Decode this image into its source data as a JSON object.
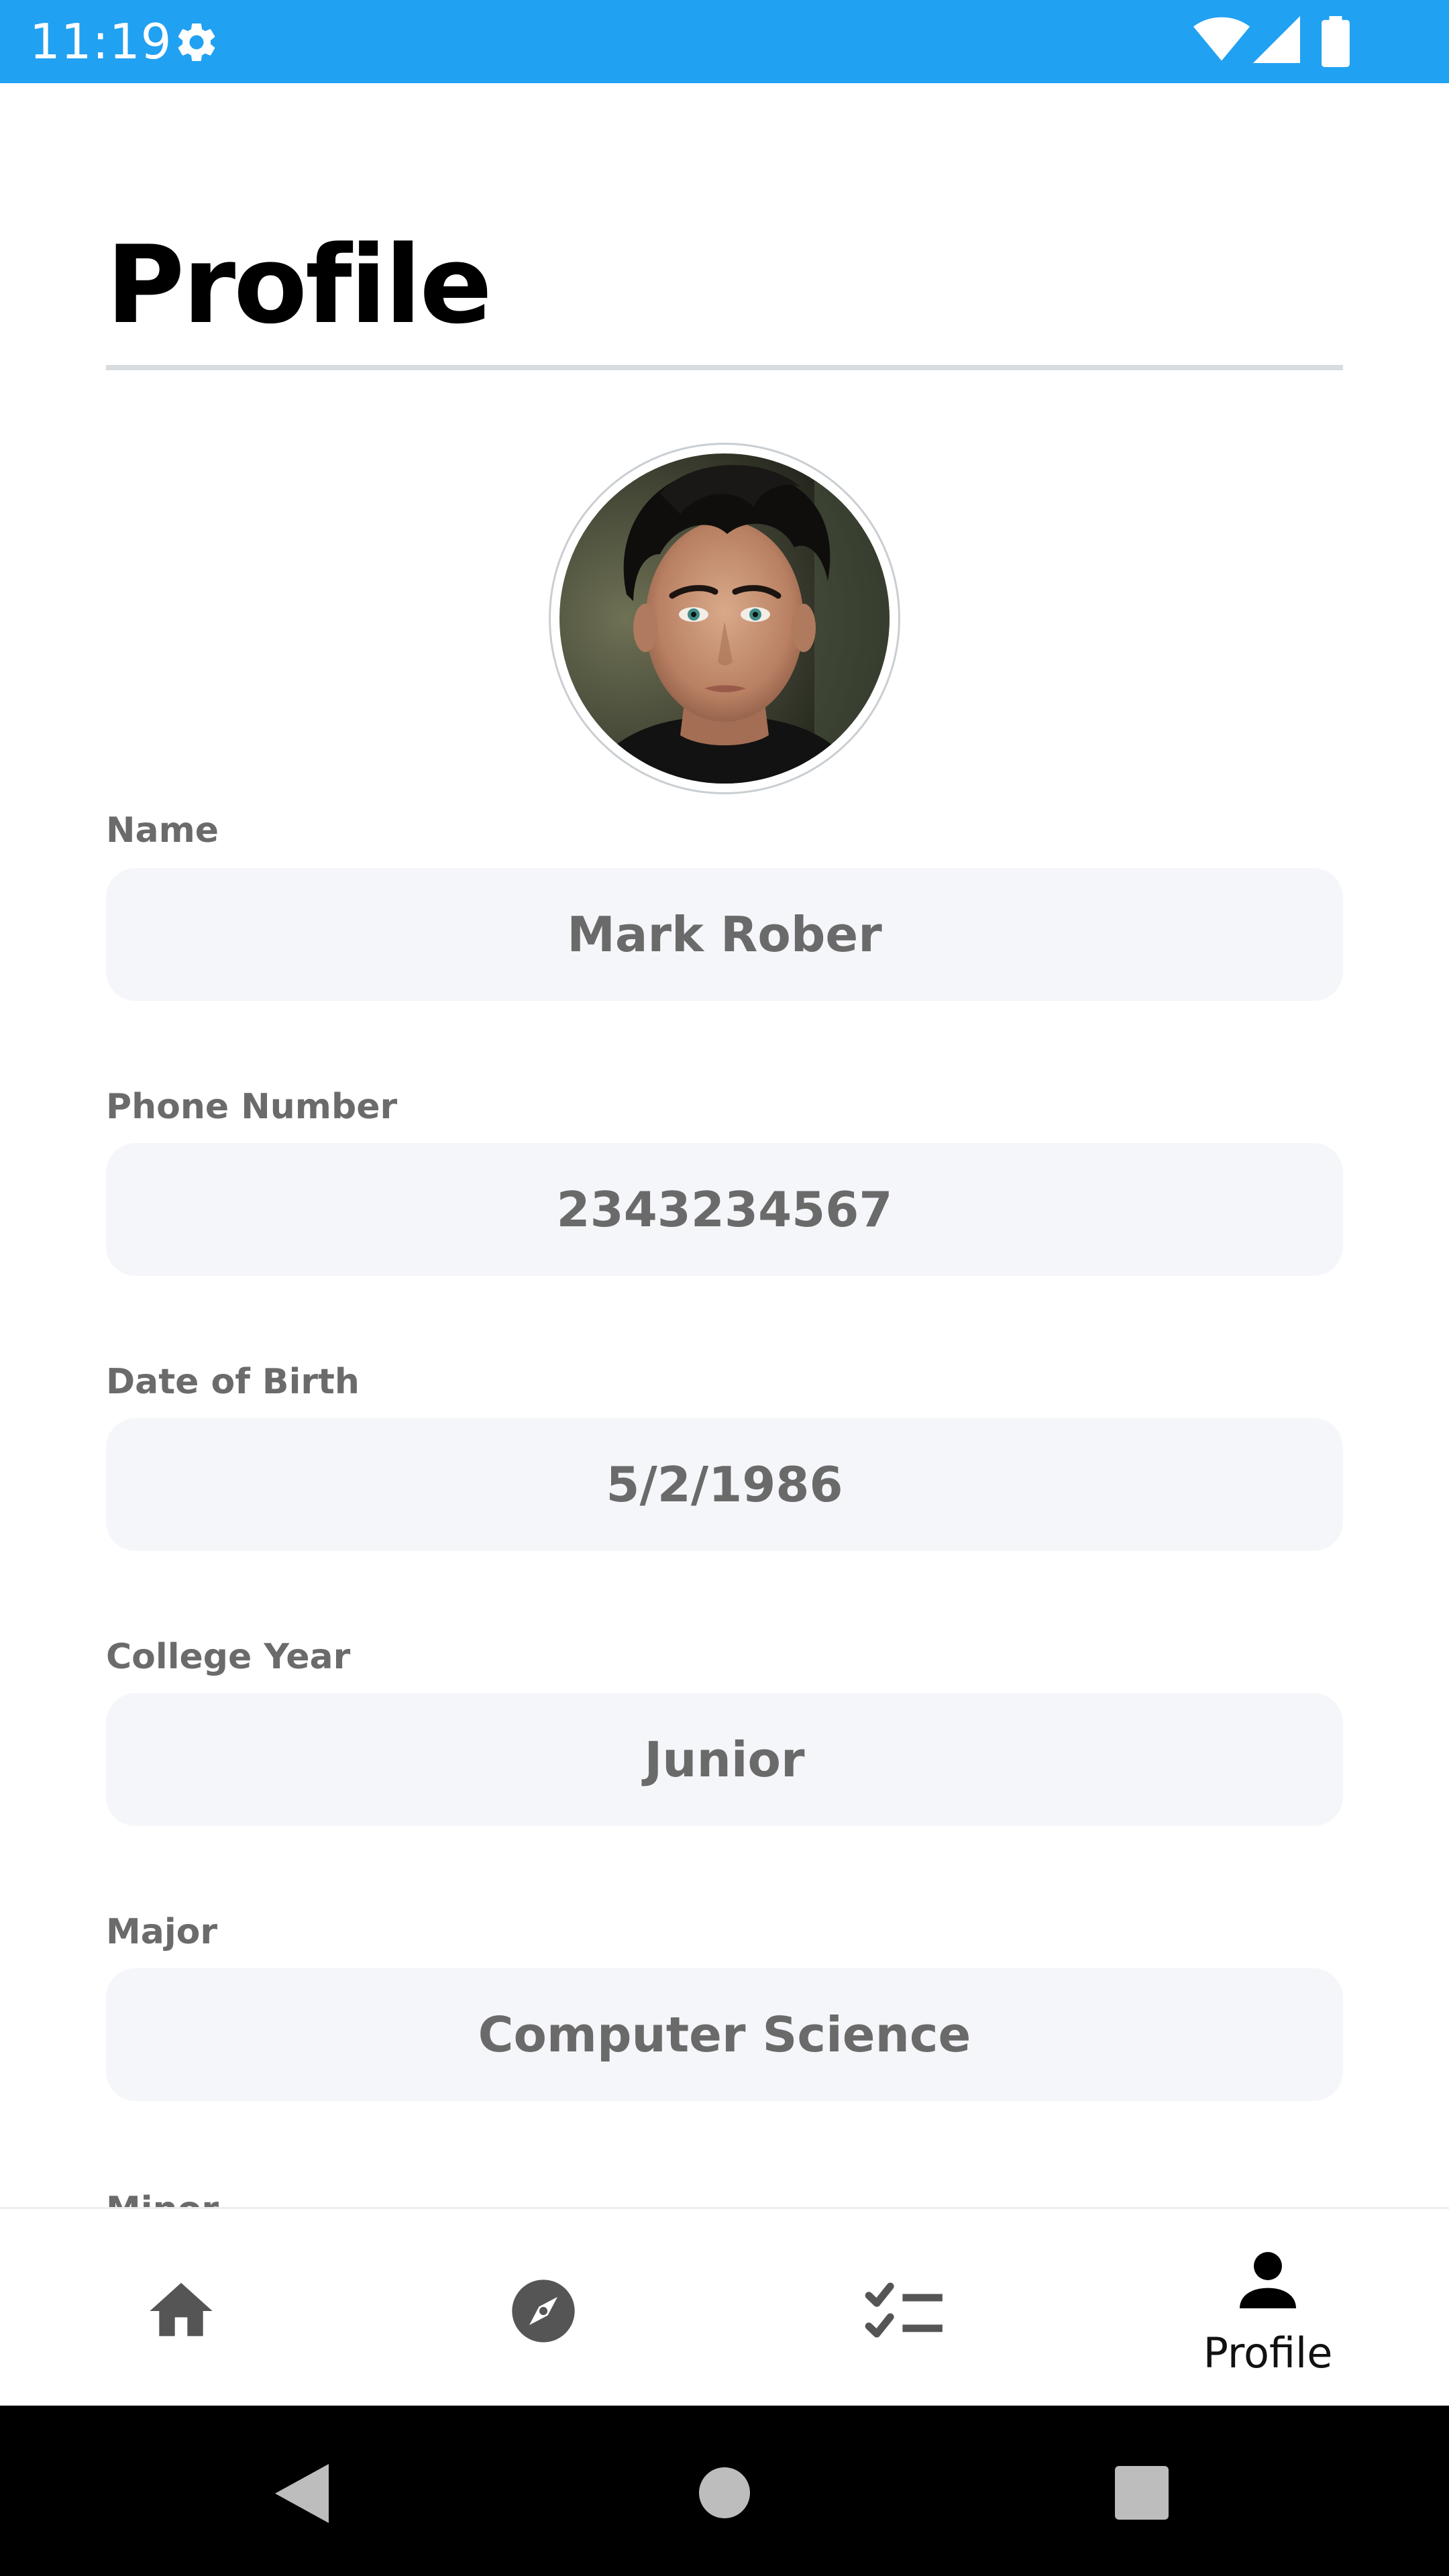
{
  "status_bar": {
    "time": "11:19",
    "background_color": "#21a1f1",
    "icons": [
      "gear-icon",
      "wifi-icon",
      "signal-icon",
      "battery-icon"
    ]
  },
  "page": {
    "title": "Profile"
  },
  "avatar": {
    "icon": "avatar-photo"
  },
  "fields": {
    "name": {
      "label": "Name",
      "value": "Mark Rober"
    },
    "phone": {
      "label": "Phone Number",
      "value": "2343234567"
    },
    "dob": {
      "label": "Date of Birth",
      "value": "5/2/1986"
    },
    "college_year": {
      "label": "College Year",
      "value": "Junior"
    },
    "major": {
      "label": "Major",
      "value": "Computer Science"
    },
    "minor": {
      "label": "Minor"
    }
  },
  "bottom_nav": {
    "items": [
      {
        "icon": "home-icon",
        "label": "",
        "active": false
      },
      {
        "icon": "compass-icon",
        "label": "",
        "active": false
      },
      {
        "icon": "checklist-icon",
        "label": "",
        "active": false
      },
      {
        "icon": "person-icon",
        "label": "Profile",
        "active": true
      }
    ]
  },
  "system_nav": {
    "buttons": [
      "back-icon",
      "home-circle-icon",
      "recents-icon"
    ]
  }
}
